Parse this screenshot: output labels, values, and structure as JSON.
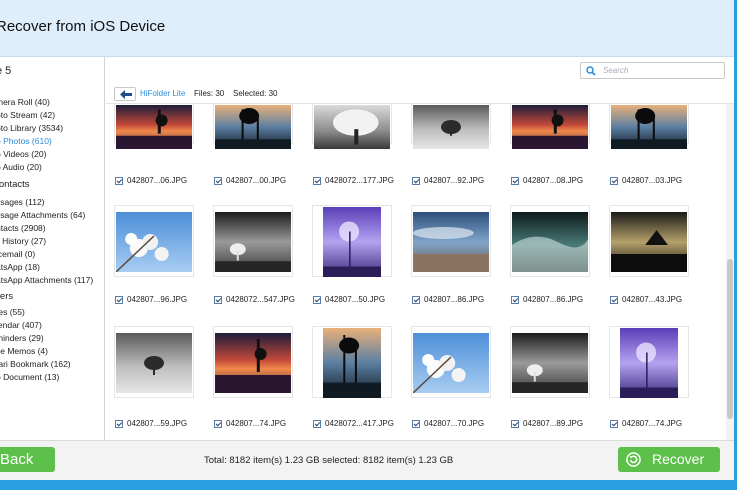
{
  "window": {
    "title": "Recover from iOS Device"
  },
  "sidebar": {
    "device": "e 5",
    "media": [
      "mera Roll (40)",
      "oto Stream (42)",
      "oto Library (3534)",
      "p Photos (610)",
      "p Videos (20)",
      "p Audio (20)"
    ],
    "active_index": 3,
    "contacts_header": "Contacts",
    "contacts": [
      "ssages (112)",
      "ssage Attachments (64)",
      "ntacts (2908)",
      "ll History (27)",
      "icemail (0)",
      "atsApp (18)",
      "atsApp Attachments (117)"
    ],
    "others_header": "thers",
    "others": [
      "tes (55)",
      "lendar (407)",
      "minders (29)",
      "ce Memos (4)",
      "fari Bookmark (162)",
      "p Document (13)"
    ]
  },
  "search": {
    "placeholder": "Search"
  },
  "pathbar": {
    "folder": "HiFolder Lite",
    "files": "Files: 30",
    "selected": "Selected: 30"
  },
  "rows": [
    [
      {
        "name": "042807...06.JPG",
        "thumb": "sunset-pier"
      },
      {
        "name": "042807...00.JPG",
        "thumb": "pier-silhouette"
      },
      {
        "name": "0428072...177.JPG",
        "thumb": "bw-tree"
      },
      {
        "name": "042807...92.JPG",
        "thumb": "bw-lone-tree"
      },
      {
        "name": "042807...08.JPG",
        "thumb": "sunset-pier"
      },
      {
        "name": "042807...03.JPG",
        "thumb": "pier-silhouette"
      }
    ],
    [
      {
        "name": "042807...96.JPG",
        "thumb": "blossom-sky"
      },
      {
        "name": "0428072...547.JPG",
        "thumb": "dark-sky-tree"
      },
      {
        "name": "042807...50.JPG",
        "thumb": "purple-lamp"
      },
      {
        "name": "042807...86.JPG",
        "thumb": "beach-clouds"
      },
      {
        "name": "042807...86.JPG",
        "thumb": "wave"
      },
      {
        "name": "042807...43.JPG",
        "thumb": "dark-beach"
      }
    ],
    [
      {
        "name": "042807...59.JPG",
        "thumb": "bw-lone-tree"
      },
      {
        "name": "042807...74.JPG",
        "thumb": "sunset-pier"
      },
      {
        "name": "0428072...417.JPG",
        "thumb": "pier-silhouette"
      },
      {
        "name": "042807...70.JPG",
        "thumb": "blossom-sky"
      },
      {
        "name": "042807...89.JPG",
        "thumb": "dark-sky-tree"
      },
      {
        "name": "042807...74.JPG",
        "thumb": "purple-lamp"
      }
    ]
  ],
  "footer": {
    "back_label": "Back",
    "totals": "Total: 8182 item(s) 1.23 GB   selected: 8182 item(s) 1.23 GB",
    "recover_label": "Recover"
  },
  "colors": {
    "accent": "#2a9fe0",
    "button": "#5cc04a",
    "link": "#2e8bd8"
  }
}
